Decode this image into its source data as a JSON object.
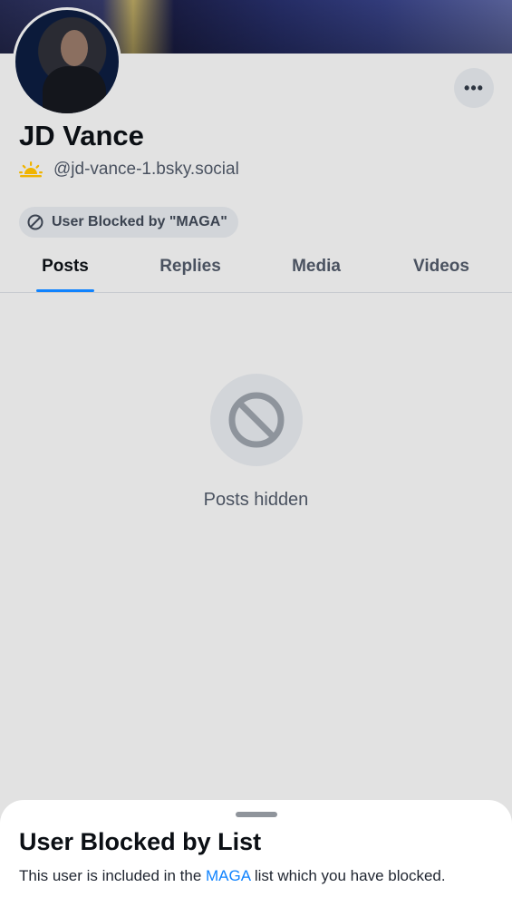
{
  "profile": {
    "display_name": "JD Vance",
    "handle": "@jd-vance-1.bsky.social",
    "handle_icon": "sunrise-icon",
    "more_label": "•••",
    "blocked_badge": "User Blocked by \"MAGA\""
  },
  "tabs": [
    {
      "label": "Posts",
      "active": true
    },
    {
      "label": "Replies",
      "active": false
    },
    {
      "label": "Media",
      "active": false
    },
    {
      "label": "Videos",
      "active": false
    }
  ],
  "content": {
    "empty_state_icon": "block-icon",
    "empty_state_text": "Posts hidden"
  },
  "sheet": {
    "title": "User Blocked by List",
    "desc_before": "This user is included in the ",
    "list_link": "MAGA",
    "desc_after": " list which you have blocked."
  },
  "colors": {
    "accent": "#1083fe",
    "sun": "#f0b400",
    "background": "#e2e2e2"
  }
}
